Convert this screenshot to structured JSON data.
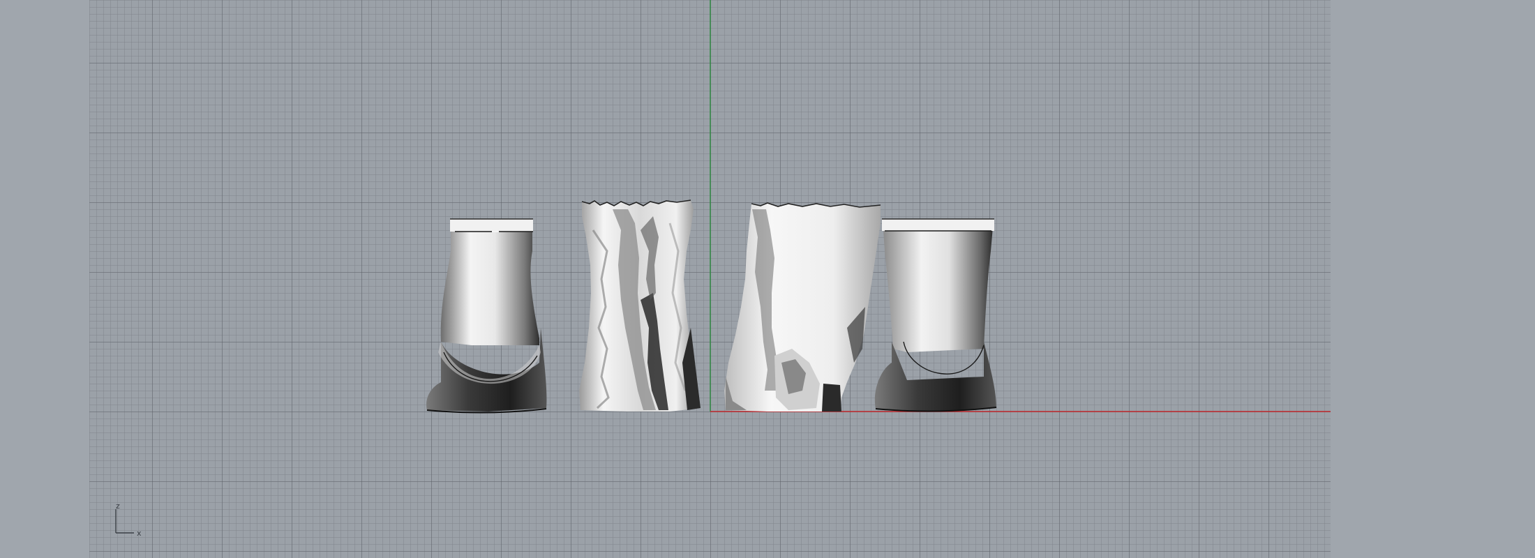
{
  "viewport": {
    "background_color": "#9ba1a8",
    "grid_line_color": "#7d8289",
    "x_axis_color": "#c0282d",
    "z_axis_color": "#2b8a3e"
  },
  "axis_gizmo": {
    "vertical_label": "z",
    "horizontal_label": "x"
  },
  "objects": [
    {
      "name": "smooth-cast-left",
      "shading": "smooth"
    },
    {
      "name": "scanned-mesh-left",
      "shading": "faceted"
    },
    {
      "name": "scanned-mesh-right",
      "shading": "faceted"
    },
    {
      "name": "smooth-cast-right",
      "shading": "smooth"
    }
  ]
}
